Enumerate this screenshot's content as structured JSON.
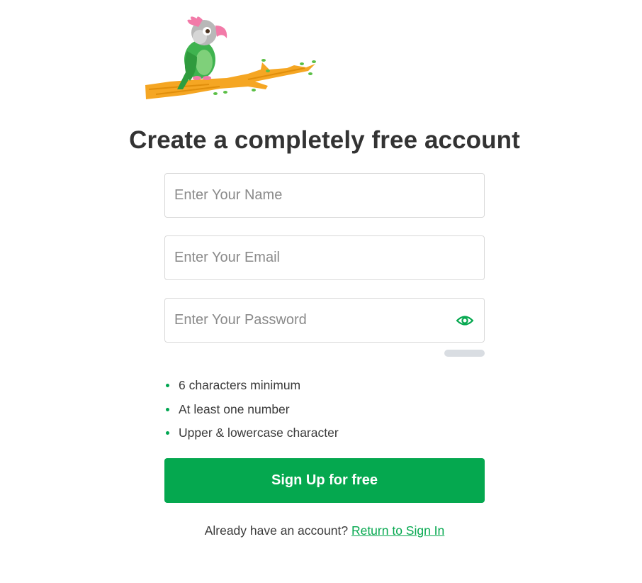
{
  "logo": {
    "icon": "parrot-on-branch-illustration"
  },
  "heading": "Create a completely free account",
  "form": {
    "name_placeholder": "Enter Your Name",
    "name_value": "",
    "email_placeholder": "Enter Your Email",
    "email_value": "",
    "password_placeholder": "Enter Your Password",
    "password_value": "",
    "show_password_icon": "eye-icon",
    "password_strength": 0
  },
  "password_rules": [
    "6 characters minimum",
    "At least one number",
    "Upper & lowercase character"
  ],
  "signup_button": "Sign Up for free",
  "footer": {
    "prompt": "Already have an account?",
    "link": "Return to Sign In"
  },
  "colors": {
    "accent": "#05a84f",
    "border": "#d9d9d9",
    "strength_track": "#d9dde2",
    "text": "#333333",
    "placeholder": "#8a8a8a"
  }
}
